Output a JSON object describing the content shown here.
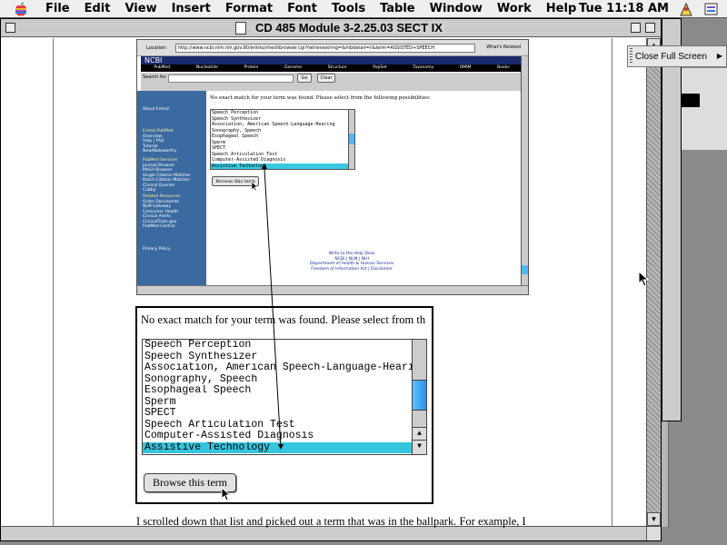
{
  "menubar": {
    "items": [
      "File",
      "Edit",
      "View",
      "Insert",
      "Format",
      "Font",
      "Tools",
      "Table",
      "Window",
      "Work",
      "Help"
    ],
    "clock": "Tue 11:18 AM"
  },
  "window": {
    "title": "CD 485 Module 3-2.25.03 SECT IX"
  },
  "floating_palette": {
    "label": "Close Full Screen"
  },
  "browser": {
    "location_label": "Location:",
    "url": "http://www.ncbi.nlm.nih.gov:80/entrez/meshbrowser.cgi?retrievestring=&mbdetail=n&term=ASSISTED+SPEECH",
    "related_label": "What's Related",
    "logo": "NCBI",
    "tabs": [
      "PubMed",
      "Nucleotide",
      "Protein",
      "Genome",
      "Structure",
      "PopSet",
      "Taxonomy",
      "OMIM",
      "Books"
    ],
    "search_label": "Search for",
    "go_label": "Go",
    "clear_label": "Clear",
    "sidebar": {
      "about": "About Entrez",
      "entrez_heading": "Entrez PubMed",
      "entrez_items": [
        "Overview",
        "Help | FAQ",
        "Tutorial",
        "New/Noteworthy"
      ],
      "services_heading": "PubMed Services",
      "services_items": [
        "Journal Browser",
        "MeSH Browser",
        "Single Citation Matcher",
        "Batch Citation Matcher",
        "Clinical Queries",
        "Cubby"
      ],
      "resources_heading": "Related Resources",
      "resources_items": [
        "Order Documents",
        "NLM Gateway",
        "Consumer Health",
        "Clinical Alerts",
        "ClinicalTrials.gov",
        "PubMed Central"
      ],
      "privacy": "Privacy Policy"
    },
    "message": "No exact match for your term was found. Please select from the following possibilities:",
    "list_items": [
      "Speech Perception",
      "Speech Synthesizer",
      "Association, American Speech-Language-Hearing",
      "Sonography, Speech",
      "Esophageal Speech",
      "Sperm",
      "SPECT",
      "Speech Articulation Test",
      "Computer-Assisted Diagnosis",
      "Assistive Technology"
    ],
    "browse_label": "Browse this term",
    "footer": [
      "Write to the Help Desk",
      "NCBI | NLM | NIH",
      "Department of Health & Human Services",
      "Freedom of Information Act | Disclaimer"
    ]
  },
  "zoom": {
    "message": "No exact match for your term was found. Please select from th",
    "list_items": [
      "Speech Perception",
      "Speech Synthesizer",
      "Association, American Speech-Language-Hearing",
      "Sonography, Speech",
      "Esophageal Speech",
      "Sperm",
      "SPECT",
      "Speech Articulation Test",
      "Computer-Assisted Diagnosis",
      "Assistive Technology"
    ],
    "selected_item": "Assistive Technology",
    "browse_label": "Browse this term"
  },
  "body_text": "I scrolled down that list and picked out a term that was in the ballpark.  For example, I",
  "colors": {
    "selection": "#35c5de",
    "sidebar": "#3a6aa0",
    "scroll_thumb": "#2e8ff0"
  }
}
